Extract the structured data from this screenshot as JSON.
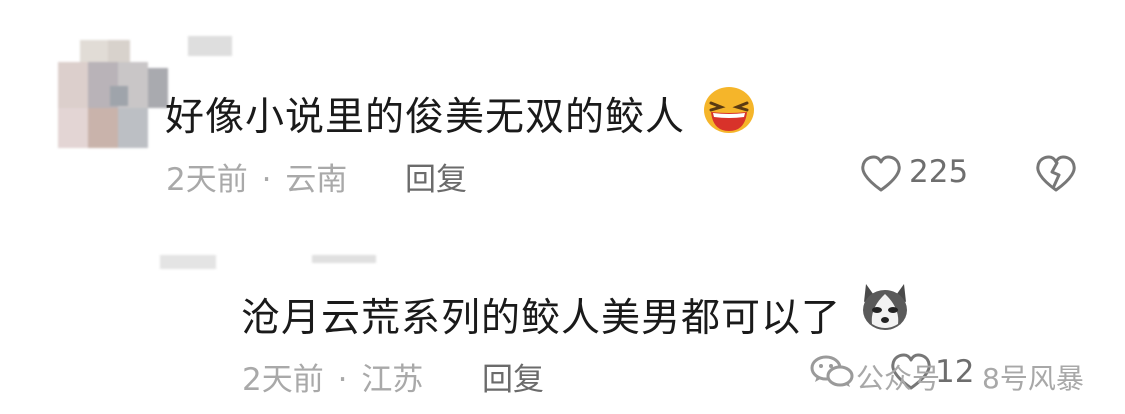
{
  "comments": [
    {
      "text": "好像小说里的俊美无双的鲛人",
      "time": "2天前",
      "location": "云南",
      "meta_sep": "·",
      "reply_label": "回复",
      "like_count": "225",
      "emoji": "laughing-face-emoji"
    },
    {
      "text": "沧月云荒系列的鲛人美男都可以了",
      "time": "2天前",
      "location": "江苏",
      "meta_sep": "·",
      "reply_label": "回复",
      "like_count": "12",
      "emoji": "husky-dog-emoji"
    }
  ],
  "watermark": {
    "prefix": "公众号",
    "name": "8号风暴"
  },
  "colors": {
    "text": "#1a1a1a",
    "meta": "#a9a9a9",
    "reply": "#6b6b6b",
    "emoji_yellow": "#f5b52a",
    "emoji_mouth": "#d8322a"
  }
}
